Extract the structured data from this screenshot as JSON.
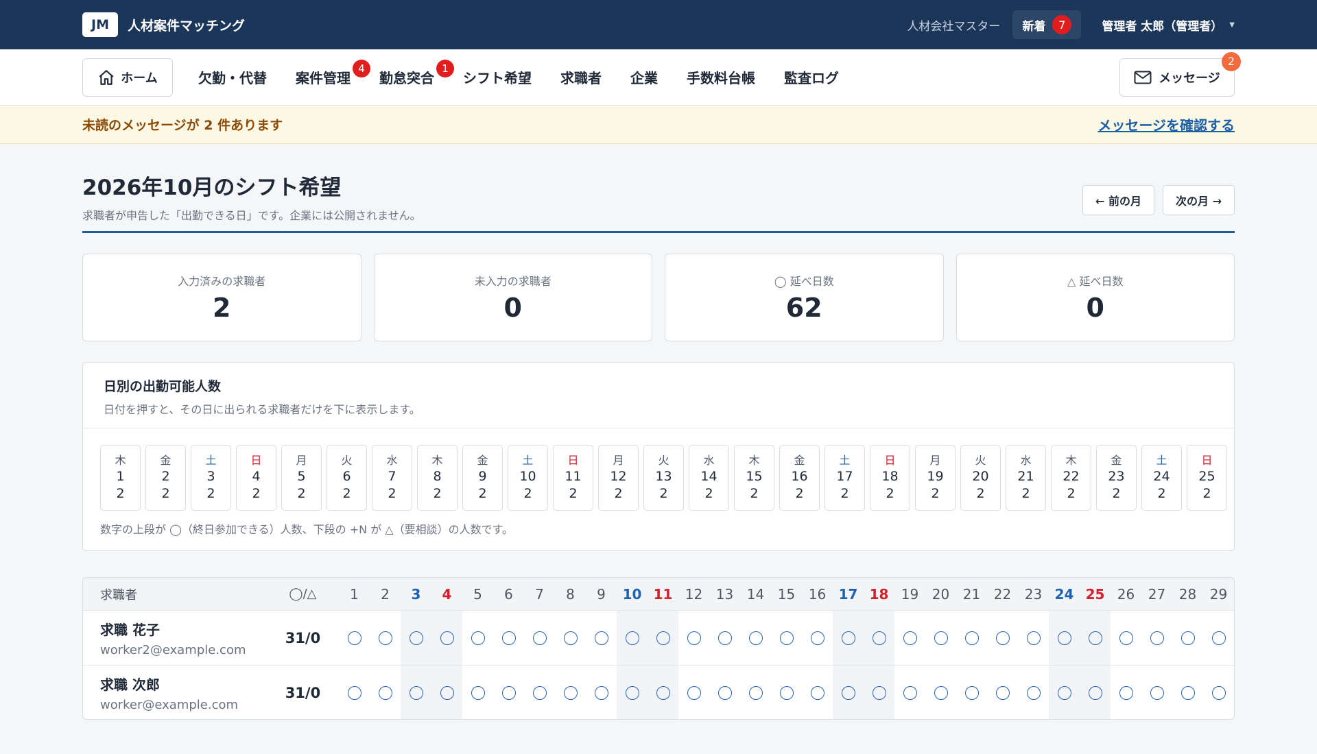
{
  "header": {
    "logo": "JM",
    "title": "人材案件マッチング",
    "company": "人材会社マスター",
    "new_label": "新着",
    "new_count": "7",
    "user": "管理者 太郎（管理者）"
  },
  "nav": {
    "home_label": "ホーム",
    "items": [
      {
        "label": "欠勤・代替",
        "badge": ""
      },
      {
        "label": "案件管理",
        "badge": "4"
      },
      {
        "label": "勤怠突合",
        "badge": "1"
      },
      {
        "label": "シフト希望",
        "badge": ""
      },
      {
        "label": "求職者",
        "badge": ""
      },
      {
        "label": "企業",
        "badge": ""
      },
      {
        "label": "手数料台帳",
        "badge": ""
      },
      {
        "label": "監査ログ",
        "badge": ""
      }
    ],
    "messages_label": "メッセージ",
    "messages_count": "2"
  },
  "alert": {
    "text": "未読のメッセージが 2 件あります",
    "link": "メッセージを確認する"
  },
  "page": {
    "title": "2026年10月のシフト希望",
    "subtitle": "求職者が申告した「出勤できる日」です。企業には公開されません。",
    "prev_label": "← 前の月",
    "next_label": "次の月 →"
  },
  "stats": [
    {
      "label": "入力済みの求職者",
      "value": "2"
    },
    {
      "label": "未入力の求職者",
      "value": "0"
    },
    {
      "label": "◯ 延べ日数",
      "value": "62"
    },
    {
      "label": "△ 延べ日数",
      "value": "0"
    }
  ],
  "daily": {
    "title": "日別の出勤可能人数",
    "subtitle": "日付を押すと、その日に出られる求職者だけを下に表示します。",
    "note": "数字の上段が ◯（終日参加できる）人数、下段の +N が △（要相談）の人数です。",
    "days": [
      {
        "dow": "木",
        "day": "1",
        "count": "2"
      },
      {
        "dow": "金",
        "day": "2",
        "count": "2"
      },
      {
        "dow": "土",
        "day": "3",
        "count": "2"
      },
      {
        "dow": "日",
        "day": "4",
        "count": "2"
      },
      {
        "dow": "月",
        "day": "5",
        "count": "2"
      },
      {
        "dow": "火",
        "day": "6",
        "count": "2"
      },
      {
        "dow": "水",
        "day": "7",
        "count": "2"
      },
      {
        "dow": "木",
        "day": "8",
        "count": "2"
      },
      {
        "dow": "金",
        "day": "9",
        "count": "2"
      },
      {
        "dow": "土",
        "day": "10",
        "count": "2"
      },
      {
        "dow": "日",
        "day": "11",
        "count": "2"
      },
      {
        "dow": "月",
        "day": "12",
        "count": "2"
      },
      {
        "dow": "火",
        "day": "13",
        "count": "2"
      },
      {
        "dow": "水",
        "day": "14",
        "count": "2"
      },
      {
        "dow": "木",
        "day": "15",
        "count": "2"
      },
      {
        "dow": "金",
        "day": "16",
        "count": "2"
      },
      {
        "dow": "土",
        "day": "17",
        "count": "2"
      },
      {
        "dow": "日",
        "day": "18",
        "count": "2"
      },
      {
        "dow": "月",
        "day": "19",
        "count": "2"
      },
      {
        "dow": "火",
        "day": "20",
        "count": "2"
      },
      {
        "dow": "水",
        "day": "21",
        "count": "2"
      },
      {
        "dow": "木",
        "day": "22",
        "count": "2"
      },
      {
        "dow": "金",
        "day": "23",
        "count": "2"
      },
      {
        "dow": "土",
        "day": "24",
        "count": "2"
      },
      {
        "dow": "日",
        "day": "25",
        "count": "2"
      }
    ]
  },
  "table": {
    "col_worker": "求職者",
    "col_count": "◯/△",
    "day_headers": [
      "1",
      "2",
      "3",
      "4",
      "5",
      "6",
      "7",
      "8",
      "9",
      "10",
      "11",
      "12",
      "13",
      "14",
      "15",
      "16",
      "17",
      "18",
      "19",
      "20",
      "21",
      "22",
      "23",
      "24",
      "25",
      "26",
      "27",
      "28",
      "29"
    ],
    "workers": [
      {
        "name": "求職 花子",
        "email": "worker2@example.com",
        "count": "31/0",
        "mark": "◯"
      },
      {
        "name": "求職 次郎",
        "email": "worker@example.com",
        "count": "31/0",
        "mark": "◯"
      }
    ]
  },
  "colors": {
    "topbar": "#1c365a",
    "accent": "#1e5c9b",
    "badge": "#e11d1d",
    "saturday": "#1e63b3",
    "sunday": "#d21f2b",
    "alert_bg": "#fdf8e3"
  }
}
